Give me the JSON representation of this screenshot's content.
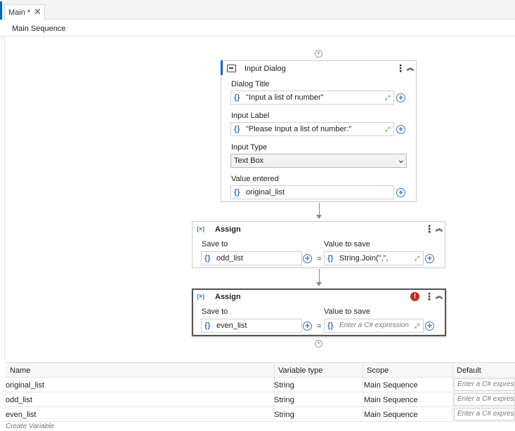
{
  "tab": {
    "label": "Main *",
    "close_glyph": "✕"
  },
  "breadcrumb": "Main Sequence",
  "input_dialog": {
    "title": "Input Dialog",
    "dialog_title_label": "Dialog Title",
    "dialog_title_value": "\"Input a list of number\"",
    "input_label_label": "Input Label",
    "input_label_value": "\"Please Input a list of number:\"",
    "input_type_label": "Input Type",
    "input_type_value": "Text Box",
    "value_entered_label": "Value entered",
    "value_entered_value": "original_list"
  },
  "assign1": {
    "title": "Assign",
    "save_to_label": "Save to",
    "save_to_value": "odd_list",
    "value_to_save_label": "Value to save",
    "value_to_save_value": "String.Join(\",\","
  },
  "assign2": {
    "title": "Assign",
    "save_to_label": "Save to",
    "save_to_value": "even_list",
    "value_to_save_label": "Value to save",
    "value_to_save_placeholder": "Enter a C# expression",
    "error_glyph": "!"
  },
  "glyphs": {
    "curly": "{}",
    "equals": "=",
    "kebab": "⋮",
    "collapse": "︽",
    "expand": "⤢",
    "plus": "+",
    "chevron": "⌄",
    "assign_icon": "(×)"
  },
  "variables": {
    "headers": {
      "name": "Name",
      "type": "Variable type",
      "scope": "Scope",
      "default": "Default"
    },
    "rows": [
      {
        "name": "original_list",
        "type": "String",
        "scope": "Main Sequence",
        "default_placeholder": "Enter a C# expression"
      },
      {
        "name": "odd_list",
        "type": "String",
        "scope": "Main Sequence",
        "default_placeholder": "Enter a C# expression"
      },
      {
        "name": "even_list",
        "type": "String",
        "scope": "Main Sequence",
        "default_placeholder": "Enter a C# expression"
      }
    ],
    "create_label": "Create Variable"
  },
  "colors": {
    "accent": "#0067c0",
    "curly": "#3a74c2",
    "error": "#c42b1c"
  }
}
